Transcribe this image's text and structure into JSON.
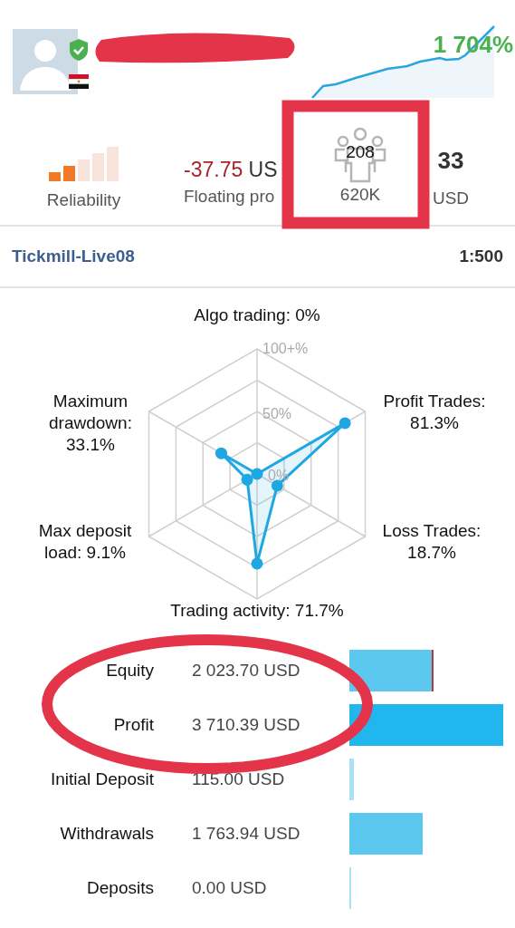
{
  "profile": {
    "verified": true,
    "gain": "1 704%"
  },
  "stats": [
    {
      "kind": "reliability",
      "label": "Reliability",
      "level": 0.4
    },
    {
      "kind": "floating",
      "value": "-37.75",
      "unit": "US",
      "label": "Floating pro"
    },
    {
      "kind": "subscribers",
      "count": "208",
      "label": "620K"
    },
    {
      "kind": "balance",
      "value": "33",
      "label": "USD"
    }
  ],
  "account": {
    "server": "Tickmill-Live08",
    "leverage": "1:500"
  },
  "radar": {
    "ticks": [
      "100+%",
      "50%",
      "0%"
    ],
    "axes": [
      {
        "label": "Algo trading: 0%"
      },
      {
        "label": "Maximum\ndrawdown:\n33.1%"
      },
      {
        "label": "Profit Trades:\n81.3%"
      },
      {
        "label": "Max deposit\nload: 9.1%"
      },
      {
        "label": "Loss Trades:\n18.7%"
      },
      {
        "label": "Trading activity: 71.7%"
      }
    ]
  },
  "balances": [
    {
      "label": "Equity",
      "value": "2 023.70 USD",
      "color": "#5cc8f0"
    },
    {
      "label": "Profit",
      "value": "3 710.39 USD",
      "color": "#22b6ef"
    },
    {
      "label": "Initial Deposit",
      "value": "115.00 USD",
      "color": "#a9e0f6"
    },
    {
      "label": "Withdrawals",
      "value": "1 763.94 USD",
      "color": "#5cc8f0"
    },
    {
      "label": "Deposits",
      "value": "0.00 USD",
      "color": "#a9e0f6"
    }
  ],
  "annotations": [
    {
      "kind": "scribble"
    },
    {
      "kind": "frame"
    },
    {
      "kind": "ellipse"
    }
  ]
}
